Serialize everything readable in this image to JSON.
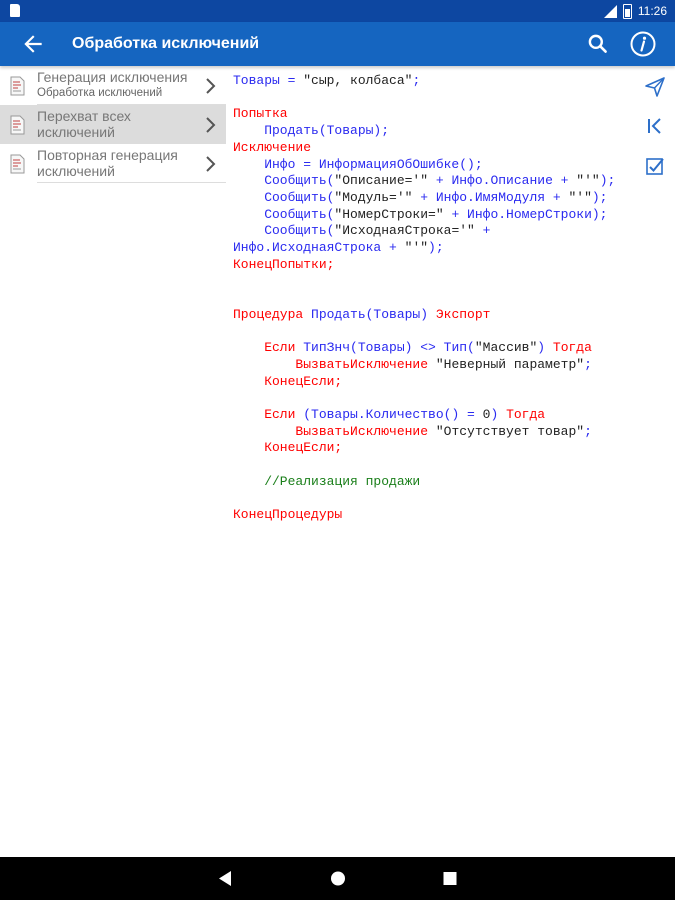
{
  "status": {
    "time": "11:26"
  },
  "app_bar": {
    "title": "Обработка исключений"
  },
  "sidebar": {
    "items": [
      {
        "title": "Генерация исключения",
        "subtitle": "Обработка исключений",
        "selected": false
      },
      {
        "title": "Перехват всех исключений",
        "subtitle": "",
        "selected": true
      },
      {
        "title": "Повторная генерация исключений",
        "subtitle": "",
        "selected": false
      }
    ]
  },
  "code": {
    "lines": [
      [
        {
          "t": "f",
          "v": "Товары = "
        },
        {
          "t": "s",
          "v": "\"сыр, колбаса\""
        },
        {
          "t": "f",
          "v": ";"
        }
      ],
      [],
      [
        {
          "t": "k",
          "v": "Попытка"
        }
      ],
      [
        {
          "t": "f",
          "v": "    Продать(Товары);"
        }
      ],
      [
        {
          "t": "k",
          "v": "Исключение"
        }
      ],
      [
        {
          "t": "f",
          "v": "    Инфо = ИнформацияОбОшибке();"
        }
      ],
      [
        {
          "t": "f",
          "v": "    Сообщить("
        },
        {
          "t": "s",
          "v": "\"Описание='\""
        },
        {
          "t": "f",
          "v": " + Инфо.Описание + "
        },
        {
          "t": "s",
          "v": "\"'\""
        },
        {
          "t": "f",
          "v": ");"
        }
      ],
      [
        {
          "t": "f",
          "v": "    Сообщить("
        },
        {
          "t": "s",
          "v": "\"Модуль='\""
        },
        {
          "t": "f",
          "v": " + Инфо.ИмяМодуля + "
        },
        {
          "t": "s",
          "v": "\"'\""
        },
        {
          "t": "f",
          "v": ");"
        }
      ],
      [
        {
          "t": "f",
          "v": "    Сообщить("
        },
        {
          "t": "s",
          "v": "\"НомерСтроки=\""
        },
        {
          "t": "f",
          "v": " + Инфо.НомерСтроки);"
        }
      ],
      [
        {
          "t": "f",
          "v": "    Сообщить("
        },
        {
          "t": "s",
          "v": "\"ИсходнаяСтрока='\""
        },
        {
          "t": "f",
          "v": " +"
        }
      ],
      [
        {
          "t": "f",
          "v": "Инфо.ИсходнаяСтрока + "
        },
        {
          "t": "s",
          "v": "\"'\""
        },
        {
          "t": "f",
          "v": ");"
        }
      ],
      [
        {
          "t": "k",
          "v": "КонецПопытки;"
        }
      ],
      [],
      [],
      [
        {
          "t": "k",
          "v": "Процедура "
        },
        {
          "t": "f",
          "v": "Продать(Товары) "
        },
        {
          "t": "k",
          "v": "Экспорт"
        }
      ],
      [],
      [
        {
          "t": "k",
          "v": "    Если "
        },
        {
          "t": "f",
          "v": "ТипЗнч(Товары) <> Тип("
        },
        {
          "t": "s",
          "v": "\"Массив\""
        },
        {
          "t": "f",
          "v": ") "
        },
        {
          "t": "k",
          "v": "Тогда"
        }
      ],
      [
        {
          "t": "k",
          "v": "        ВызватьИсключение "
        },
        {
          "t": "s",
          "v": "\"Неверный параметр\""
        },
        {
          "t": "f",
          "v": ";"
        }
      ],
      [
        {
          "t": "k",
          "v": "    КонецЕсли;"
        }
      ],
      [],
      [
        {
          "t": "k",
          "v": "    Если "
        },
        {
          "t": "f",
          "v": "(Товары.Количество() = "
        },
        {
          "t": "s",
          "v": "0"
        },
        {
          "t": "f",
          "v": ") "
        },
        {
          "t": "k",
          "v": "Тогда"
        }
      ],
      [
        {
          "t": "k",
          "v": "        ВызватьИсключение "
        },
        {
          "t": "s",
          "v": "\"Отсутствует товар\""
        },
        {
          "t": "f",
          "v": ";"
        }
      ],
      [
        {
          "t": "k",
          "v": "    КонецЕсли;"
        }
      ],
      [],
      [
        {
          "t": "c",
          "v": "    //Реализация продажи"
        }
      ],
      [],
      [
        {
          "t": "k",
          "v": "КонецПроцедуры"
        }
      ]
    ]
  },
  "icons": {
    "back": "arrow-back-icon",
    "search": "search-icon",
    "info": "info-icon",
    "send": "send-icon",
    "first": "skip-previous-icon",
    "check": "checkbox-icon",
    "doc": "document-icon"
  },
  "colors": {
    "status_bar": "#0d47a1",
    "app_bar": "#1565c0",
    "keyword": "#ff0000",
    "identifier": "#2a2af0",
    "string": "#222222",
    "comment": "#1a7f1a",
    "selected_item": "#dcdcdc",
    "tool_icon": "#2d6fc9"
  }
}
